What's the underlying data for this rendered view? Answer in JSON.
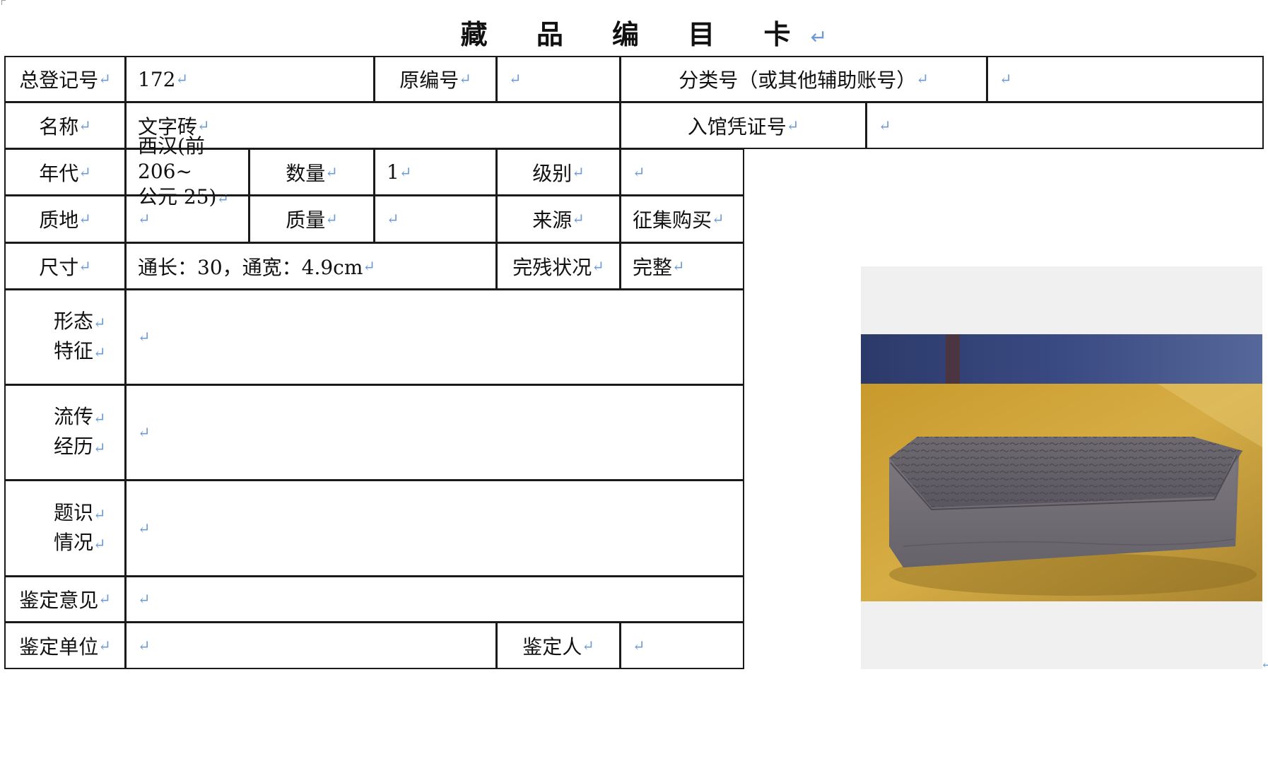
{
  "title": "藏 品 编 目 卡",
  "pilcrow": "↵",
  "fields": {
    "total_reg_no": {
      "label": "总登记号",
      "value": "172"
    },
    "orig_no": {
      "label": "原编号",
      "value": ""
    },
    "class_no": {
      "label": "分类号（或其他辅助账号）",
      "value": ""
    },
    "name": {
      "label": "名称",
      "value": "文字砖"
    },
    "entry_voucher": {
      "label": "入馆凭证号",
      "value": ""
    },
    "era": {
      "label": "年代",
      "value_line1": "西汉(前 206~",
      "value_line2": "公元 25)"
    },
    "quantity": {
      "label": "数量",
      "value": "1"
    },
    "grade": {
      "label": "级别",
      "value": ""
    },
    "material": {
      "label": "质地",
      "value": ""
    },
    "weight": {
      "label": "质量",
      "value": ""
    },
    "source": {
      "label": "来源",
      "value": "征集购买"
    },
    "size": {
      "label": "尺寸",
      "value": "通长：30，通宽：4.9cm"
    },
    "condition": {
      "label": "完残状况",
      "value": "完整"
    },
    "morphology": {
      "label_line1": "形态",
      "label_line2": "特征",
      "value": ""
    },
    "provenance": {
      "label_line1": "流传",
      "label_line2": "经历",
      "value": ""
    },
    "inscription": {
      "label_line1": "题识",
      "label_line2": "情况",
      "value": ""
    },
    "appraisal_opinion": {
      "label": "鉴定意见",
      "value": ""
    },
    "appraisal_unit": {
      "label": "鉴定单位",
      "value": ""
    },
    "appraiser": {
      "label": "鉴定人",
      "value": ""
    }
  },
  "colors": {
    "border": "#1a1a1a",
    "paragraph_mark": "#6f9bd4",
    "photo_bg": "#f0f0f0"
  }
}
